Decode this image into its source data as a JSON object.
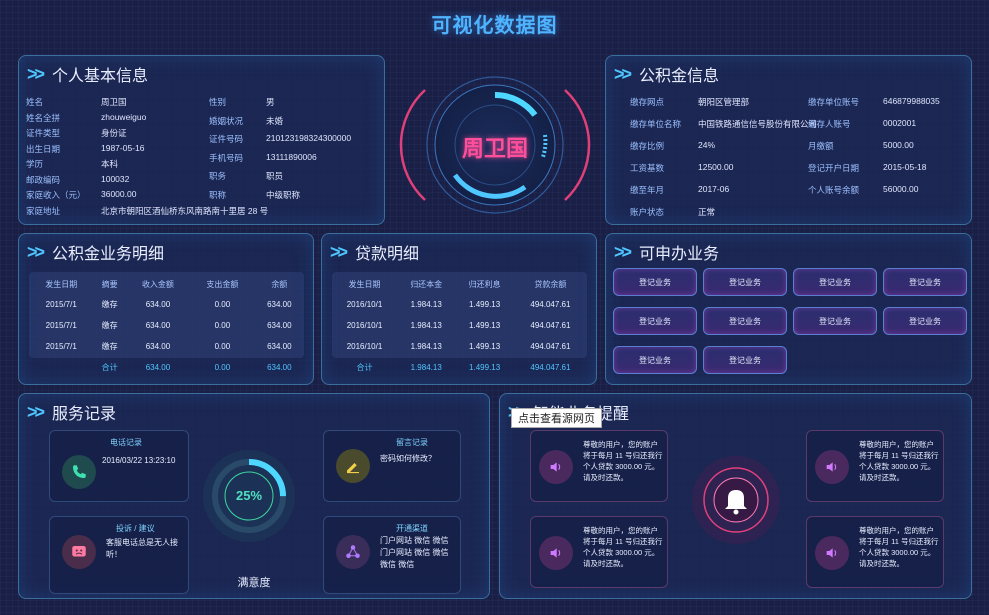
{
  "page": {
    "title": "可视化数据图"
  },
  "center": {
    "name": "周卫国"
  },
  "personal": {
    "title": "个人基本信息",
    "left": [
      {
        "k": "姓名",
        "v": "周卫国"
      },
      {
        "k": "姓名全拼",
        "v": "zhouweiguo"
      },
      {
        "k": "证件类型",
        "v": "身份证"
      },
      {
        "k": "出生日期",
        "v": "1987-05-16"
      },
      {
        "k": "学历",
        "v": "本科"
      },
      {
        "k": "邮政编码",
        "v": "100032"
      },
      {
        "k": "家庭收入（元）",
        "v": "36000.00"
      }
    ],
    "right": [
      {
        "k": "性别",
        "v": "男"
      },
      {
        "k": "婚姻状况",
        "v": "未婚"
      },
      {
        "k": "证件号码",
        "v": "210123198324300000"
      },
      {
        "k": "手机号码",
        "v": "13111890006"
      },
      {
        "k": "职务",
        "v": "职员"
      },
      {
        "k": "职称",
        "v": "中级职称"
      }
    ],
    "address": {
      "k": "家庭地址",
      "v": "北京市朝阳区酒仙桥东风南路南十里居 28 号"
    }
  },
  "fund_info": {
    "title": "公积金信息",
    "left": [
      {
        "k": "缴存网点",
        "v": "朝阳区管理部"
      },
      {
        "k": "缴存单位名称",
        "v": "中国铁路通信信号股份有限公司"
      },
      {
        "k": "缴存比例",
        "v": "24%"
      },
      {
        "k": "工资基数",
        "v": "12500.00"
      },
      {
        "k": "缴至年月",
        "v": "2017-06"
      },
      {
        "k": "账户状态",
        "v": "正常"
      }
    ],
    "right": [
      {
        "k": "缴存单位账号",
        "v": "646879988035"
      },
      {
        "k": "缴存人账号",
        "v": "0002001"
      },
      {
        "k": "月缴额",
        "v": "5000.00"
      },
      {
        "k": "登记开户日期",
        "v": "2015-05-18"
      },
      {
        "k": "个人账号余额",
        "v": "56000.00"
      }
    ]
  },
  "fund_detail": {
    "title": "公积金业务明细",
    "headers": [
      "发生日期",
      "摘要",
      "收入金额",
      "支出金额",
      "余额"
    ],
    "rows": [
      [
        "2015/7/1",
        "缴存",
        "634.00",
        "0.00",
        "634.00"
      ],
      [
        "2015/7/1",
        "缴存",
        "634.00",
        "0.00",
        "634.00"
      ],
      [
        "2015/7/1",
        "缴存",
        "634.00",
        "0.00",
        "634.00"
      ]
    ],
    "total": [
      "",
      "合计",
      "634.00",
      "0.00",
      "634.00"
    ]
  },
  "loan_detail": {
    "title": "贷款明细",
    "headers": [
      "发生日期",
      "归还本金",
      "归还利息",
      "贷款余额"
    ],
    "rows": [
      [
        "2016/10/1",
        "1.984.13",
        "1.499.13",
        "494.047.61"
      ],
      [
        "2016/10/1",
        "1.984.13",
        "1.499.13",
        "494.047.61"
      ],
      [
        "2016/10/1",
        "1.984.13",
        "1.499.13",
        "494.047.61"
      ]
    ],
    "total": [
      "合计",
      "1.984.13",
      "1.499.13",
      "494.047.61"
    ]
  },
  "business": {
    "title": "可申办业务",
    "buttons": [
      "登记业务",
      "登记业务",
      "登记业务",
      "登记业务",
      "登记业务",
      "登记业务",
      "登记业务",
      "登记业务",
      "登记业务",
      "登记业务"
    ]
  },
  "service": {
    "title": "服务记录",
    "phone": {
      "title": "电话记录",
      "text": "2016/03/22 13:23:10"
    },
    "message": {
      "title": "留言记录",
      "text": "密码如何修改？"
    },
    "complaint": {
      "title": "投诉 / 建议",
      "text": "客服电话总是无人接听！"
    },
    "channel": {
      "title": "开通渠道",
      "text": "门户网站  微信  微信 门户网站  微信  微信 微信  微信"
    },
    "satisfaction": {
      "value": "25%",
      "label": "满意度",
      "percent": 25
    }
  },
  "reminder": {
    "title": "智能业务提醒",
    "tooltip": "点击查看源网页",
    "items": [
      "尊敬的用户，您的账户将于每月 11 号归还我行个人贷款 3000.00 元。请及时还款。",
      "尊敬的用户，您的账户将于每月 11 号归还我行个人贷款 3000.00 元。请及时还款。",
      "尊敬的用户，您的账户将于每月 11 号归还我行个人贷款 3000.00 元。请及时还款。",
      "尊敬的用户，您的账户将于每月 11 号归还我行个人贷款 3000.00 元。请及时还款。"
    ]
  },
  "colors": {
    "accent": "#4fc6ff",
    "pink": "#ff4fa0",
    "panel_border": "#3a6e9c"
  }
}
